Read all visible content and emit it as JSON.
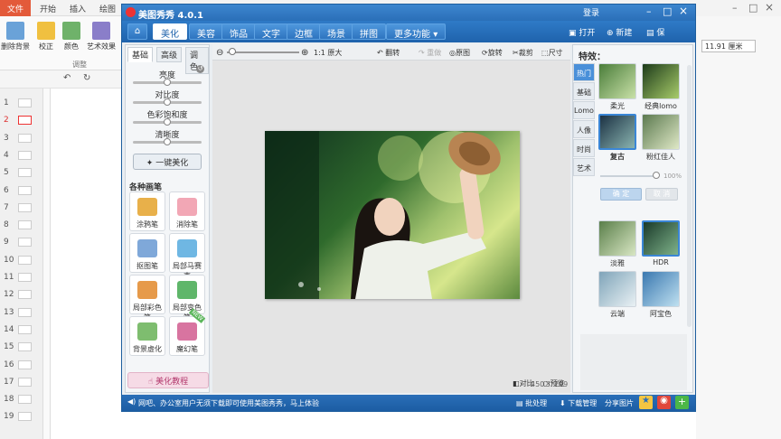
{
  "bg_app": {
    "tabs": [
      "文件",
      "开始",
      "插入",
      "绘图"
    ],
    "ribbon": [
      {
        "label": "删除背景",
        "icon": "remove-bg-icon"
      },
      {
        "label": "校正",
        "icon": "correct-icon"
      },
      {
        "label": "颜色",
        "icon": "color-icon"
      },
      {
        "label": "艺术效果",
        "icon": "art-effect-icon"
      }
    ],
    "group_label": "调整",
    "size_value": "11.91 厘米",
    "right_top": [
      "登录"
    ],
    "slides": [
      "1",
      "2",
      "3",
      "4",
      "5",
      "6",
      "7",
      "8",
      "9",
      "10",
      "11",
      "12",
      "13",
      "14",
      "15",
      "16",
      "17",
      "18",
      "19"
    ],
    "selected_slide": "2"
  },
  "mt": {
    "title": "美图秀秀 4.0.1",
    "nav": [
      "美化",
      "美容",
      "饰品",
      "文字",
      "边框",
      "场景",
      "拼图",
      "更多功能"
    ],
    "active_nav": "美化",
    "open_label": "打开",
    "new_label": "新建",
    "save_label": "保",
    "left": {
      "subtabs": [
        "基础",
        "高级",
        "调色"
      ],
      "sliders": [
        "亮度",
        "对比度",
        "色彩饱和度",
        "清晰度"
      ],
      "one_click": "一键美化",
      "tools_title": "各种画笔",
      "tools": [
        "涂鸦笔",
        "消除笔",
        "抠图笔",
        "局部马赛克",
        "局部彩色笔",
        "局部变色笔",
        "背景虚化",
        "魔幻笔"
      ],
      "tutorial": "美化教程",
      "badge_new": "NEW"
    },
    "toolbar": {
      "zoom_ratio": "1:1 原大",
      "flip": "翻转",
      "redo": "重做",
      "original": "原图",
      "rotate": "旋转",
      "crop": "裁剪",
      "size": "尺寸"
    },
    "image_info": {
      "width": "450",
      "times": "×",
      "height": "299",
      "compare": "对比",
      "preview": "预览"
    },
    "right": {
      "title": "特效：",
      "tabs": [
        "热门",
        "基础",
        "Lomo",
        "人像",
        "时尚",
        "艺术"
      ],
      "effects_top": [
        "柔光",
        "经典lomo",
        "复古",
        "粉红佳人"
      ],
      "selected_effect": "复古",
      "percent": "100%",
      "ok": "确 定",
      "cancel": "取 消",
      "effects_bottom": [
        "淡雅",
        "HDR",
        "云端",
        "阿宝色"
      ]
    },
    "status": {
      "message": "网吧、办公室用户无须下载即可使用美图秀秀，马上体验",
      "batch": "批处理",
      "download": "下载管理",
      "share": "分享图片"
    }
  },
  "colors": {
    "accent": "#2a6fb8",
    "brand_red": "#e35a3a"
  }
}
